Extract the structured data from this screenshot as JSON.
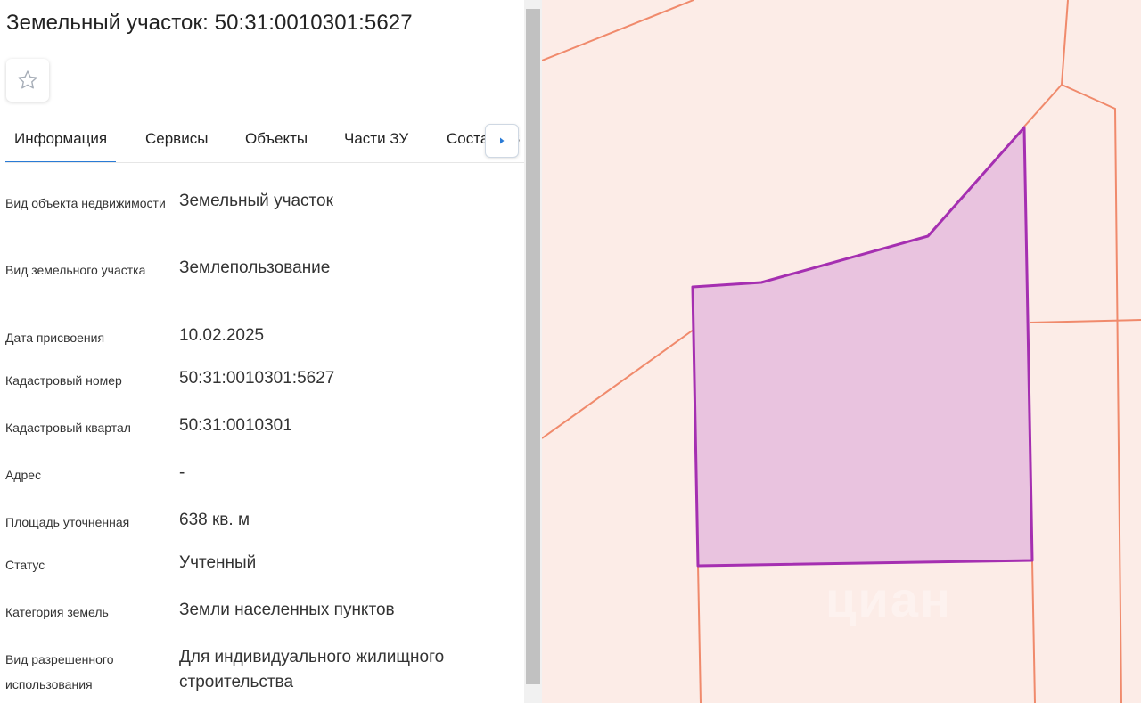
{
  "title": "Земельный участок: 50:31:0010301:5627",
  "favorite_icon": "star-outline-icon",
  "tabs": [
    {
      "label": "Информация",
      "active": true
    },
    {
      "label": "Сервисы"
    },
    {
      "label": "Объекты"
    },
    {
      "label": "Части ЗУ"
    },
    {
      "label": "Состав ЕЗ"
    }
  ],
  "tab_next_icon": "chevron-right-icon",
  "accent_color": "#2a7bd6",
  "info": {
    "object_type": {
      "label": "Вид объекта недвижимости",
      "value": "Земельный участок"
    },
    "land_type": {
      "label": "Вид земельного участка",
      "value": "Землепользование"
    },
    "assign_date": {
      "label": "Дата присвоения",
      "value": "10.02.2025"
    },
    "cadastral_number": {
      "label": "Кадастровый номер",
      "value": "50:31:0010301:5627"
    },
    "cadastral_quarter": {
      "label": "Кадастровый квартал",
      "value": "50:31:0010301"
    },
    "address": {
      "label": "Адрес",
      "value": "-"
    },
    "area": {
      "label": "Площадь уточненная",
      "value": "638 кв. м"
    },
    "status": {
      "label": "Статус",
      "value": "Учтенный"
    },
    "land_category": {
      "label": "Категория земель",
      "value": "Земли населенных пунктов"
    },
    "permitted_use": {
      "label": "Вид разрешенного использования",
      "value": "Для индивидуального жилищного строительства"
    }
  },
  "map": {
    "background_color": "#fcece7",
    "parcel_border_color": "#f08a6c",
    "selected_fill_color": "#e9c3df",
    "selected_stroke_color": "#a52fb1",
    "watermark": "циан"
  }
}
